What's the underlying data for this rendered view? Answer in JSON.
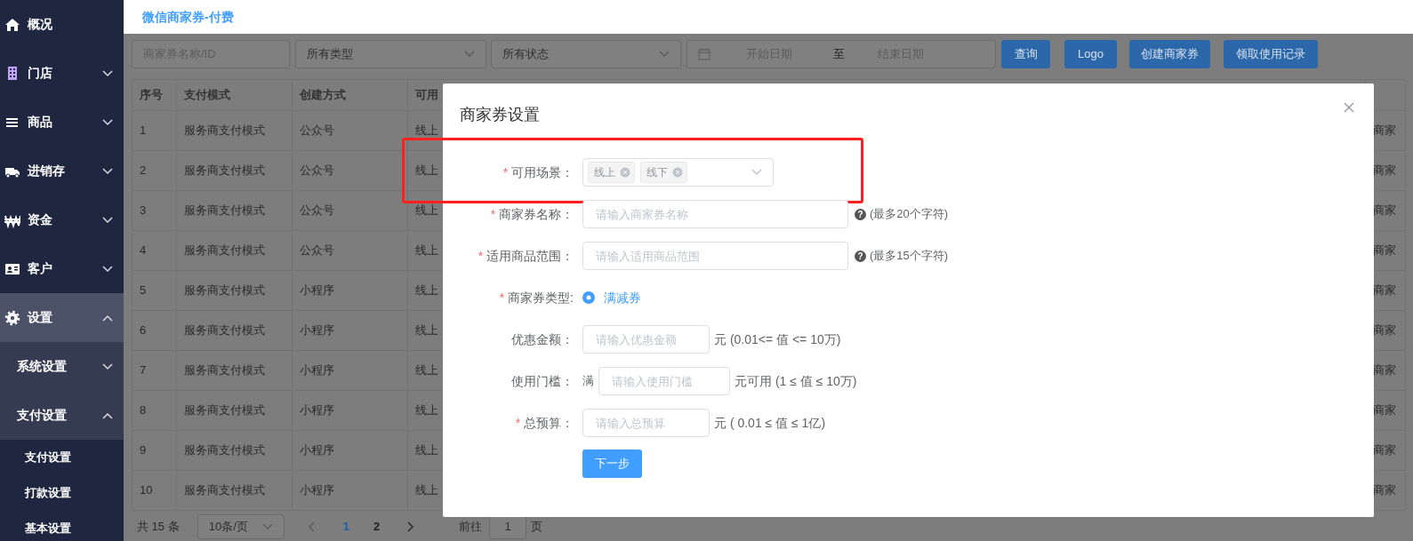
{
  "header": {
    "title": "微信商家券-付费"
  },
  "sidebar": {
    "items": [
      {
        "label": "概况",
        "selected": false
      },
      {
        "label": "门店",
        "selected": false,
        "expanded": false
      },
      {
        "label": "商品",
        "selected": false,
        "expanded": false
      },
      {
        "label": "进销存",
        "selected": false,
        "expanded": false
      },
      {
        "label": "资金",
        "selected": false,
        "expanded": false
      },
      {
        "label": "客户",
        "selected": false,
        "expanded": false
      },
      {
        "label": "设置",
        "selected": true,
        "expanded": true,
        "children": [
          {
            "label": "系统设置",
            "expanded": false
          },
          {
            "label": "支付设置",
            "expanded": true,
            "children": [
              {
                "label": "支付设置"
              },
              {
                "label": "打款设置"
              },
              {
                "label": "基本设置"
              }
            ]
          }
        ]
      }
    ]
  },
  "filters": {
    "search": {
      "placeholder": "商家券名称/ID"
    },
    "type_select": {
      "value": "所有类型"
    },
    "status_select": {
      "value": "所有状态"
    },
    "date_range": {
      "start_placeholder": "开始日期",
      "separator": "至",
      "end_placeholder": "结束日期"
    },
    "buttons": [
      "查询",
      "Logo",
      "创建商家券",
      "领取使用记录"
    ]
  },
  "table": {
    "columns": [
      "序号",
      "支付模式",
      "创建方式",
      "可用"
    ],
    "rows": [
      {
        "cells": [
          "1",
          "服务商支付模式",
          "公众号",
          "线上"
        ],
        "right_edge_cell": "商家"
      },
      {
        "cells": [
          "2",
          "服务商支付模式",
          "公众号",
          "线上"
        ],
        "right_edge_cell": "商家"
      },
      {
        "cells": [
          "3",
          "服务商支付模式",
          "公众号",
          "线上"
        ],
        "right_edge_cell": "商家"
      },
      {
        "cells": [
          "4",
          "服务商支付模式",
          "公众号",
          "线上"
        ],
        "right_edge_cell": "商家"
      },
      {
        "cells": [
          "5",
          "服务商支付模式",
          "小程序",
          "线上"
        ],
        "right_edge_cell": "商家"
      },
      {
        "cells": [
          "6",
          "服务商支付模式",
          "小程序",
          "线上"
        ],
        "right_edge_cell": "商家"
      },
      {
        "cells": [
          "7",
          "服务商支付模式",
          "小程序",
          "线上"
        ],
        "right_edge_cell": "商家"
      },
      {
        "cells": [
          "8",
          "服务商支付模式",
          "小程序",
          "线上"
        ],
        "right_edge_cell": "商家"
      },
      {
        "cells": [
          "9",
          "服务商支付模式",
          "小程序",
          "线上"
        ],
        "right_edge_cell": "商家"
      },
      {
        "cells": [
          "10",
          "服务商支付模式",
          "小程序",
          "线上"
        ],
        "right_edge_cell": "商家"
      }
    ]
  },
  "pagination": {
    "total": "共 15 条",
    "page_size": "10条/页",
    "pages": [
      {
        "label": "1",
        "selected": true
      },
      {
        "label": "2",
        "selected": false
      }
    ],
    "goto_label": "前往",
    "goto_value": "1",
    "page_unit": "页"
  },
  "modal": {
    "title": "商家券设置",
    "fields": [
      {
        "kind": "multiselect",
        "label": "可用场景：",
        "required_mark": "*",
        "highlighted": true,
        "tags": [
          "线上",
          "线下"
        ]
      },
      {
        "kind": "input",
        "label": "商家券名称：",
        "required_mark": "*",
        "highlighted": false,
        "placeholder": "请输入商家券名称",
        "help_mark": "?",
        "hint": "(最多20个字符)"
      },
      {
        "kind": "input",
        "label": "适用商品范围：",
        "required_mark": "*",
        "highlighted": false,
        "placeholder": "请输入适用商品范围",
        "help_mark": "?",
        "hint": "(最多15个字符)"
      },
      {
        "kind": "radio",
        "label": "商家券类型:",
        "required_mark": "*",
        "highlighted": false,
        "options": [
          {
            "label": "满减券",
            "selected": true
          }
        ]
      },
      {
        "kind": "input",
        "label": "优惠金额：",
        "highlighted": false,
        "placeholder": "请输入优惠金额",
        "suffix": "元 (0.01<= 值 <= 10万)"
      },
      {
        "kind": "input",
        "label": "使用门槛：",
        "highlighted": false,
        "prefix": "满",
        "placeholder": "请输入使用门槛",
        "suffix": "元可用 (1 ≤ 值 ≤ 10万)"
      },
      {
        "kind": "input",
        "label": "总预算：",
        "required_mark": "*",
        "highlighted": false,
        "placeholder": "请输入总预算",
        "suffix": "元 ( 0.01 ≤ 值 ≤ 1亿)"
      }
    ],
    "submit": "下一步"
  }
}
